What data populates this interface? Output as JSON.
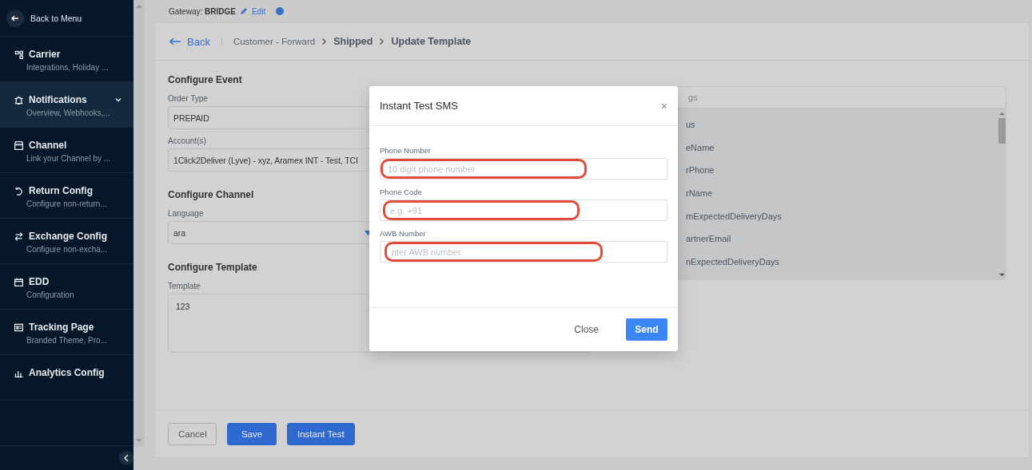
{
  "sidebar": {
    "back_label": "Back to Menu",
    "items": [
      {
        "title": "Carrier",
        "subtitle": "Integrations, Holiday ...",
        "selected": false,
        "expandable": false
      },
      {
        "title": "Notifications",
        "subtitle": "Overview, Webhooks,...",
        "selected": true,
        "expandable": true
      },
      {
        "title": "Channel",
        "subtitle": "Link your Channel by ...",
        "selected": false,
        "expandable": false
      },
      {
        "title": "Return Config",
        "subtitle": "Configure non-return...",
        "selected": false,
        "expandable": false
      },
      {
        "title": "Exchange Config",
        "subtitle": "Configure non-excha...",
        "selected": false,
        "expandable": false
      },
      {
        "title": "EDD",
        "subtitle": "Configuration",
        "selected": false,
        "expandable": false
      },
      {
        "title": "Tracking Page",
        "subtitle": "Branded Theme, Pro...",
        "selected": false,
        "expandable": false
      },
      {
        "title": "Analytics Config",
        "selected": false,
        "expandable": false
      }
    ]
  },
  "header": {
    "gateway_label": "Gateway:",
    "gateway_value": "BRIDGE",
    "edit_link": "Edit"
  },
  "breadcrumb": {
    "back": "Back",
    "crumbs": [
      {
        "label": "Customer - Forward",
        "kind": "parent"
      },
      {
        "label": "Shipped",
        "kind": "step"
      },
      {
        "label": "Update Template",
        "kind": "current"
      }
    ]
  },
  "sections": [
    {
      "title": "Configure Event",
      "fields": [
        {
          "label": "Order Type",
          "value": "PREPAID",
          "kind": "text"
        },
        {
          "label": "Account(s)",
          "value": "1Click2Deliver (Lyve) - xyz, Aramex INT - Test, TCI",
          "kind": "text"
        }
      ]
    },
    {
      "title": "Configure Channel",
      "fields": [
        {
          "label": "Language",
          "value": "ara",
          "kind": "select"
        }
      ]
    },
    {
      "title": "Configure Template",
      "fields": [
        {
          "label": "Template",
          "value": "123",
          "kind": "textarea"
        }
      ]
    }
  ],
  "tags": {
    "placeholder": "gs",
    "items": [
      "us",
      "eName",
      "rPhone",
      "rName",
      "mExpectedDeliveryDays",
      "artnerEmail",
      "nExpectedDeliveryDays"
    ]
  },
  "actions": [
    {
      "label": "Cancel",
      "kind": "secondary"
    },
    {
      "label": "Save",
      "kind": "primary"
    },
    {
      "label": "Instant Test",
      "kind": "primary"
    }
  ],
  "modal": {
    "title": "Instant Test SMS",
    "close_icon": "×",
    "fields": [
      {
        "label": "Phone Number",
        "placeholder": "10 digit phone number",
        "highlighted": true
      },
      {
        "label": "Phone Code",
        "placeholder": "e.g. +91",
        "highlighted": true
      },
      {
        "label": "AWB Number",
        "placeholder": "nter AWB number",
        "highlighted": true
      }
    ],
    "buttons": [
      {
        "label": "Close",
        "kind": "text"
      },
      {
        "label": "Send",
        "kind": "primary"
      }
    ]
  }
}
